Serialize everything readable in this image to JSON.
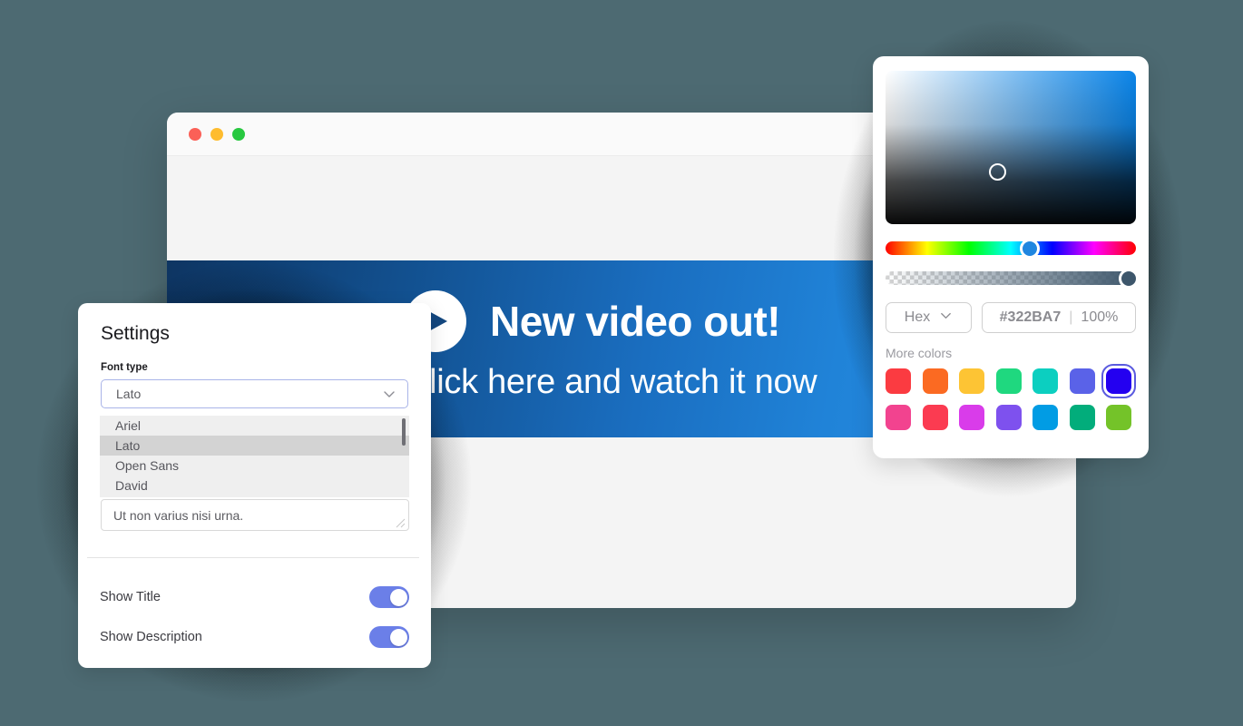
{
  "background_color": "#4d6a72",
  "browser_window": {
    "name": "browser-window",
    "traffic_lights": [
      {
        "name": "close",
        "color": "#fb6057"
      },
      {
        "name": "minimize",
        "color": "#febc2e"
      },
      {
        "name": "maximize",
        "color": "#28c840"
      }
    ],
    "banner": {
      "play_icon": "play-icon",
      "title": "New video out!",
      "subtitle": "Click here and watch it now",
      "gradient_from": "#0e3562",
      "gradient_to": "#2688de"
    }
  },
  "settings_panel": {
    "title": "Settings",
    "font_type": {
      "label": "Font type",
      "value": "Lato",
      "chevron_icon": "chevron-down-icon",
      "options": [
        {
          "label": "Ariel",
          "selected": false
        },
        {
          "label": "Lato",
          "selected": true
        },
        {
          "label": "Open Sans",
          "selected": false
        },
        {
          "label": "David",
          "selected": false
        }
      ]
    },
    "description": {
      "value": "Ut non varius nisi urna.",
      "resize_grip_icon": "resize-grip-icon"
    },
    "toggles": [
      {
        "label": "Show Title",
        "on": true,
        "color": "#6b7fe8"
      },
      {
        "label": "Show Description",
        "on": true,
        "color": "#6b7fe8"
      }
    ]
  },
  "color_picker": {
    "sv_area_name": "saturation-value-area",
    "sv_handle_name": "saturation-value-handle",
    "hue_slider_name": "hue-slider",
    "alpha_slider_name": "alpha-slider",
    "mode": "Hex",
    "mode_chevron_icon": "chevron-down-icon",
    "hex_value": "#322BA7",
    "separator": "|",
    "opacity": "100%",
    "more_colors_label": "More colors",
    "swatches": [
      {
        "name": "swatch-red",
        "color": "#fb3b41",
        "active": false
      },
      {
        "name": "swatch-orange",
        "color": "#fb6a22",
        "active": false
      },
      {
        "name": "swatch-yellow",
        "color": "#fdc434",
        "active": false
      },
      {
        "name": "swatch-green",
        "color": "#1fd87f",
        "active": false
      },
      {
        "name": "swatch-teal",
        "color": "#0ccfc0",
        "active": false
      },
      {
        "name": "swatch-indigo",
        "color": "#5a62e8",
        "active": false
      },
      {
        "name": "swatch-blue-violet",
        "color": "#2400f0",
        "active": true
      },
      {
        "name": "swatch-pink",
        "color": "#f2438f",
        "active": false
      },
      {
        "name": "swatch-crimson",
        "color": "#fb3b51",
        "active": false
      },
      {
        "name": "swatch-magenta",
        "color": "#d93cea",
        "active": false
      },
      {
        "name": "swatch-purple",
        "color": "#7e51ee",
        "active": false
      },
      {
        "name": "swatch-sky",
        "color": "#019ce4",
        "active": false
      },
      {
        "name": "swatch-emerald",
        "color": "#02ad7b",
        "active": false
      },
      {
        "name": "swatch-lime",
        "color": "#74c329",
        "active": false
      }
    ]
  }
}
